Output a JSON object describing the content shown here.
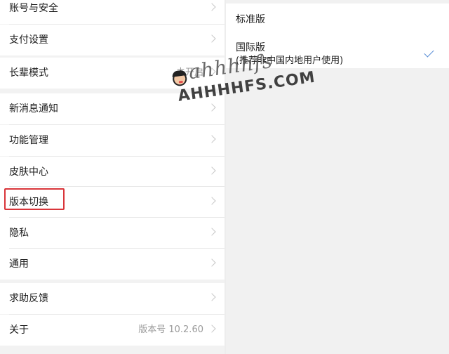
{
  "settings": {
    "account_security": "账号与安全",
    "payment_settings": "支付设置",
    "elder_mode": "长辈模式",
    "elder_mode_value": "未开启",
    "new_message_notify": "新消息通知",
    "feature_management": "功能管理",
    "skin_center": "皮肤中心",
    "version_switch": "版本切换",
    "privacy": "隐私",
    "general": "通用",
    "help_feedback": "求助反馈",
    "about": "关于",
    "about_value": "版本号 10.2.60"
  },
  "version_options": {
    "standard": "标准版",
    "international": "国际版",
    "international_note": "(推荐非中国内地用户使用)",
    "selected": "international"
  },
  "watermark": {
    "lower": "ahhhhfs",
    "upper": "AHHHHFS.COM"
  },
  "colors": {
    "highlight": "#d9353a",
    "check": "#5b8fd6"
  }
}
